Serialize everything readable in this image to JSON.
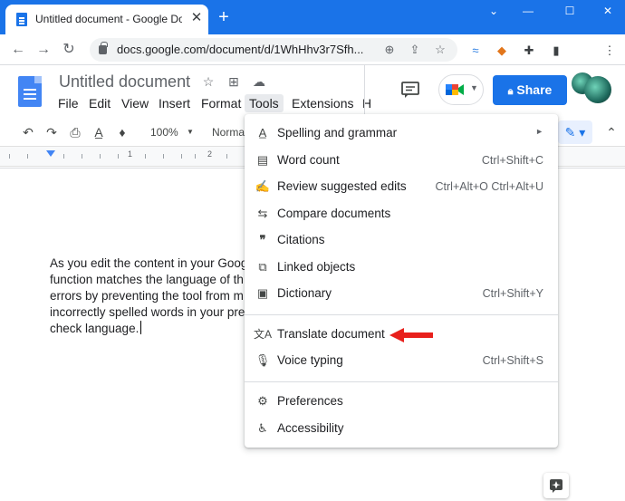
{
  "browser": {
    "tab_title": "Untitled document - Google Docs",
    "tab_close": "✕",
    "new_tab": "+",
    "url": "docs.google.com/document/d/1WhHhv3r7Sfh..."
  },
  "docs": {
    "title": "Untitled document",
    "menu": [
      "File",
      "Edit",
      "View",
      "Insert",
      "Format",
      "Tools",
      "Extensions",
      "H"
    ],
    "share_label": "Share"
  },
  "toolbar": {
    "zoom": "100%",
    "style": "Normal"
  },
  "ruler": {
    "numbers": [
      "1",
      "2"
    ]
  },
  "document": {
    "lines": [
      "As you edit the content in your Goog",
      "function matches the language of th",
      "errors by preventing the tool from m",
      "incorrectly spelled words in your pre",
      "check language."
    ]
  },
  "tools_menu": {
    "items": [
      {
        "label": "Spelling and grammar",
        "shortcut": "",
        "submenu": true,
        "icon": "spellcheck-icon"
      },
      {
        "label": "Word count",
        "shortcut": "Ctrl+Shift+C",
        "icon": "word-count-icon"
      },
      {
        "label": "Review suggested edits",
        "shortcut": "Ctrl+Alt+O Ctrl+Alt+U",
        "icon": "review-edits-icon"
      },
      {
        "label": "Compare documents",
        "shortcut": "",
        "icon": "compare-icon"
      },
      {
        "label": "Citations",
        "shortcut": "",
        "icon": "quote-icon"
      },
      {
        "label": "Linked objects",
        "shortcut": "",
        "icon": "linked-objects-icon"
      },
      {
        "label": "Dictionary",
        "shortcut": "Ctrl+Shift+Y",
        "icon": "dictionary-icon"
      },
      {
        "label": "Translate document",
        "shortcut": "",
        "icon": "translate-icon"
      },
      {
        "label": "Voice typing",
        "shortcut": "Ctrl+Shift+S",
        "icon": "microphone-icon"
      },
      {
        "label": "Preferences",
        "shortcut": "",
        "icon": "preferences-icon"
      },
      {
        "label": "Accessibility",
        "shortcut": "",
        "icon": "accessibility-icon"
      }
    ]
  },
  "colors": {
    "chrome_blue": "#1a73e8",
    "arrow_red": "#e8201c"
  }
}
